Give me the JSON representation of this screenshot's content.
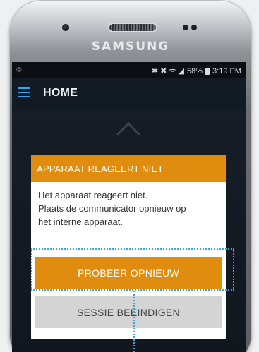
{
  "device": {
    "brand": "SAMSUNG"
  },
  "status_bar": {
    "left_icon": "signal-icon",
    "icons": "✱ ✖ ᯤ ◢",
    "battery": "58%",
    "time": "3:19 PM"
  },
  "app_bar": {
    "title": "HOME",
    "menu_icon": "hamburger-menu-icon"
  },
  "dialog": {
    "title": "APPARAAT REAGEERT NIET",
    "message_line1": "Het apparaat reageert niet.",
    "message_line2": "Plaats de communicator opnieuw op",
    "message_line3": "het interne apparaat.",
    "primary_button": "PROBEER OPNIEUW",
    "secondary_button": "SESSIE BEËINDIGEN"
  },
  "colors": {
    "accent_orange": "#e08c0e",
    "highlight_blue": "#3aa4dd",
    "menu_blue": "#2fa4e7",
    "secondary_gray": "#d4d4d4"
  }
}
